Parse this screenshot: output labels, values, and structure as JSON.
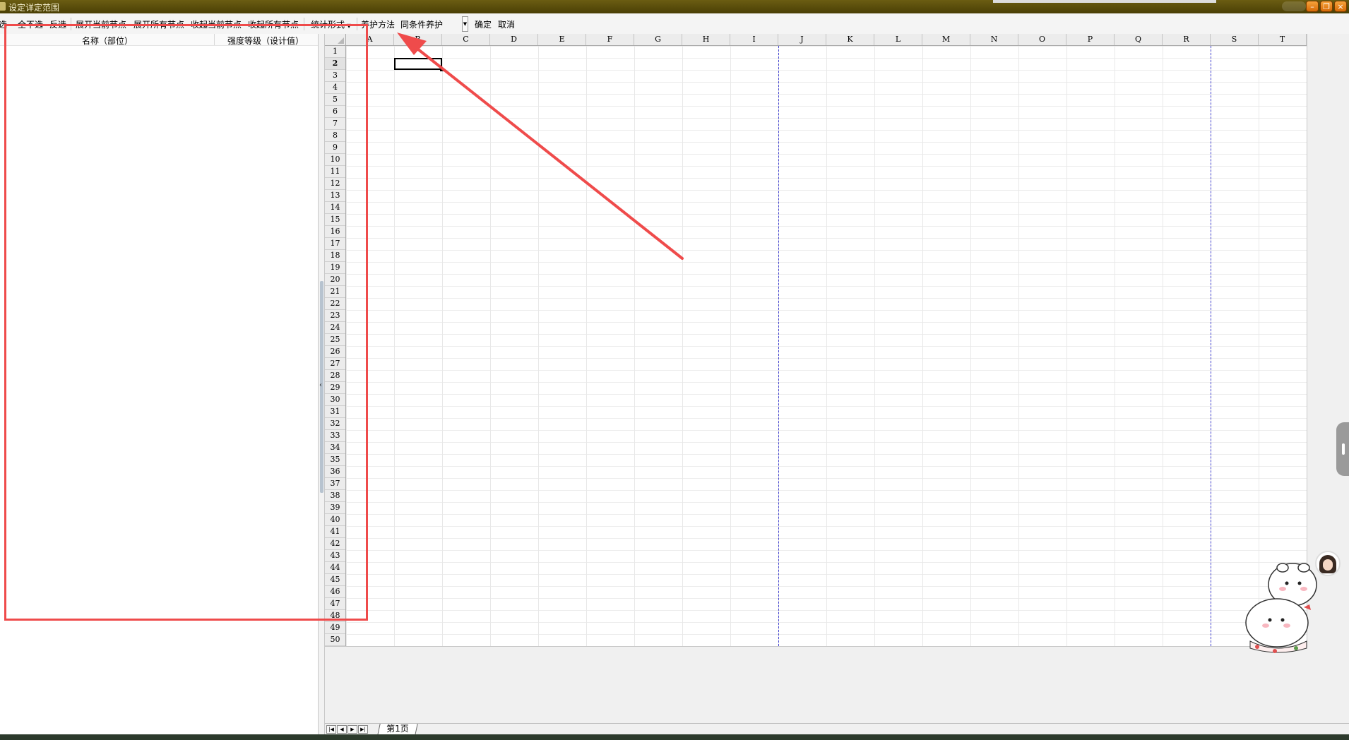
{
  "window": {
    "title": "设定详定范围",
    "controls": {
      "minimize": "–",
      "restore": "❐",
      "close": "×"
    }
  },
  "toolbar": {
    "select_all": "全选",
    "select_none": "全不选",
    "invert_selection": "反选",
    "expand_current": "展开当前节点",
    "expand_all": "展开所有节点",
    "collapse_current": "收起当前节点",
    "collapse_all": "收起所有节点",
    "stat_form": "统计形式",
    "curing_method": "养护方法",
    "same_condition_curing": "同条件养护",
    "confirm": "确定",
    "cancel": "取消"
  },
  "tree": {
    "columns": {
      "name": "名称（部位）",
      "grade": "强度等级（设计值）"
    }
  },
  "sheet": {
    "columns": [
      "A",
      "B",
      "C",
      "D",
      "E",
      "F",
      "G",
      "H",
      "I",
      "J",
      "K",
      "L",
      "M",
      "N",
      "O",
      "P",
      "Q",
      "R",
      "S",
      "T"
    ],
    "rows": [
      "1",
      "2",
      "3",
      "4",
      "5",
      "6",
      "7",
      "8",
      "9",
      "10",
      "11",
      "12",
      "13",
      "14",
      "15",
      "16",
      "17",
      "18",
      "19",
      "20",
      "21",
      "22",
      "23",
      "24",
      "25",
      "26",
      "27",
      "28",
      "29",
      "30",
      "31",
      "32",
      "33",
      "34",
      "35",
      "36",
      "37",
      "38",
      "39",
      "40",
      "41",
      "42",
      "43",
      "44",
      "45",
      "46",
      "47",
      "48",
      "49",
      "50"
    ],
    "active_row": "2",
    "active_cell": "B2",
    "tab": "第1页"
  },
  "colors": {
    "titlebar": "#5a4d0b",
    "annotation": "#ef4b4b",
    "page_break": "#4040d0"
  },
  "icons": {
    "collapse": "chevron-left-icon",
    "tab_first": "first-page-icon",
    "tab_prev": "prev-page-icon",
    "tab_next": "next-page-icon",
    "tab_last": "last-page-icon"
  }
}
